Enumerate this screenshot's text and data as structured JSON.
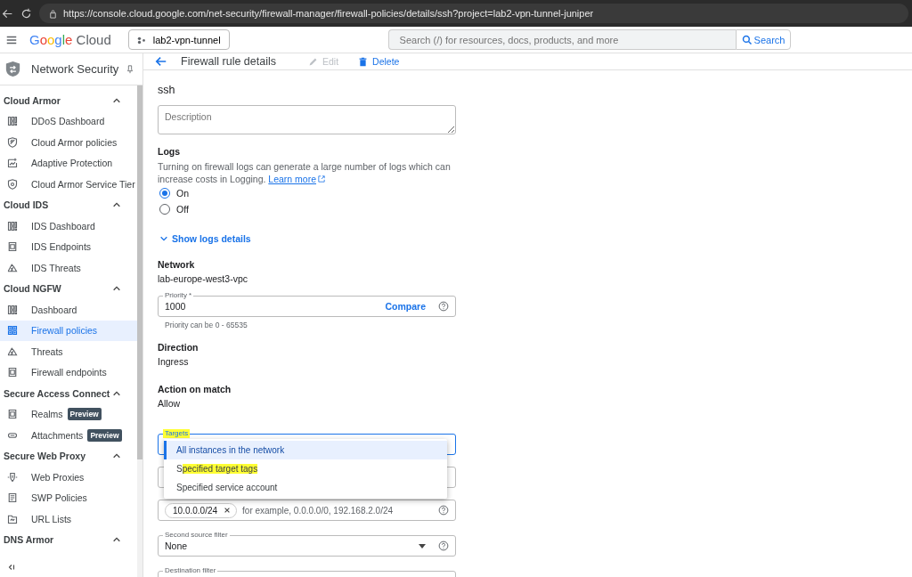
{
  "browser": {
    "url": "https://console.cloud.google.com/net-security/firewall-manager/firewall-policies/details/ssh?project=lab2-vpn-tunnel-juniper"
  },
  "header": {
    "logo_word": "Google",
    "logo_product": "Cloud",
    "project": "lab2-vpn-tunnel",
    "search": {
      "placeholder": "Search (/) for resources, docs, products, and more",
      "button": "Search"
    }
  },
  "sidebar": {
    "title": "Network Security",
    "sections": [
      {
        "title": "Cloud Armor",
        "expanded": true,
        "items": [
          {
            "label": "DDoS Dashboard",
            "kind": "dashboard",
            "selected": false
          },
          {
            "label": "Cloud Armor policies",
            "kind": "shield",
            "selected": false
          },
          {
            "label": "Adaptive Protection",
            "kind": "chart",
            "selected": false
          },
          {
            "label": "Cloud Armor Service Tier",
            "kind": "tier",
            "selected": false
          }
        ]
      },
      {
        "title": "Cloud IDS",
        "expanded": true,
        "items": [
          {
            "label": "IDS Dashboard",
            "kind": "dashboard",
            "selected": false
          },
          {
            "label": "IDS Endpoints",
            "kind": "endpoint",
            "selected": false
          },
          {
            "label": "IDS Threats",
            "kind": "threat",
            "selected": false
          }
        ]
      },
      {
        "title": "Cloud NGFW",
        "expanded": true,
        "items": [
          {
            "label": "Dashboard",
            "kind": "dashboard",
            "selected": false
          },
          {
            "label": "Firewall policies",
            "kind": "grid",
            "selected": true
          },
          {
            "label": "Threats",
            "kind": "threat",
            "selected": false
          },
          {
            "label": "Firewall endpoints",
            "kind": "endpoint",
            "selected": false
          }
        ]
      },
      {
        "title": "Secure Access Connect",
        "expanded": true,
        "items": [
          {
            "label": "Realms",
            "kind": "endpoint",
            "badge": "Preview",
            "selected": false
          },
          {
            "label": "Attachments",
            "kind": "link",
            "badge": "Preview",
            "selected": false
          }
        ]
      },
      {
        "title": "Secure Web Proxy",
        "expanded": true,
        "items": [
          {
            "label": "Web Proxies",
            "kind": "proxy",
            "selected": false
          },
          {
            "label": "SWP Policies",
            "kind": "doc",
            "selected": false
          },
          {
            "label": "URL Lists",
            "kind": "folder",
            "selected": false
          }
        ]
      },
      {
        "title": "DNS Armor",
        "expanded": true
      }
    ]
  },
  "page": {
    "title": "Firewall rule details",
    "actions": [
      {
        "label": "Edit",
        "kind": "edit",
        "disabled": true
      },
      {
        "label": "Delete",
        "kind": "delete",
        "disabled": false
      }
    ]
  },
  "form": {
    "name": "ssh",
    "description": {
      "placeholder": "Description"
    },
    "logs": {
      "label": "Logs",
      "help": "Turning on firewall logs can generate a large number of logs which can increase costs in Logging.",
      "link": "Learn more",
      "options": [
        {
          "label": "On",
          "selected": true
        },
        {
          "label": "Off",
          "selected": false
        }
      ],
      "details_toggle": "Show logs details"
    },
    "network": {
      "label": "Network",
      "value": "lab-europe-west3-vpc"
    },
    "priority": {
      "label": "Priority *",
      "value": "1000",
      "action": "Compare",
      "hint": "Priority can be 0 - 65535"
    },
    "direction": {
      "label": "Direction",
      "value": "Ingress"
    },
    "action_on_match": {
      "label": "Action on match",
      "value": "Allow"
    },
    "targets": {
      "label": "Targets",
      "label_highlighted": true,
      "options": [
        {
          "parts": [
            {
              "text": "All instances in the network",
              "highlighted": false
            }
          ],
          "selected": true
        },
        {
          "parts": [
            {
              "text": "S",
              "highlighted": false
            },
            {
              "text": "pecified target tags",
              "highlighted": true
            }
          ],
          "selected": false
        },
        {
          "parts": [
            {
              "text": "Specified service account",
              "highlighted": false
            }
          ],
          "selected": false
        }
      ]
    },
    "source_ranges": {
      "chip": "10.0.0.0/24",
      "placeholder": "for example, 0.0.0.0/0, 192.168.2.0/24"
    },
    "second_source_filter": {
      "label": "Second source filter",
      "value": "None"
    },
    "destination_filter": {
      "label": "Destination filter"
    }
  }
}
